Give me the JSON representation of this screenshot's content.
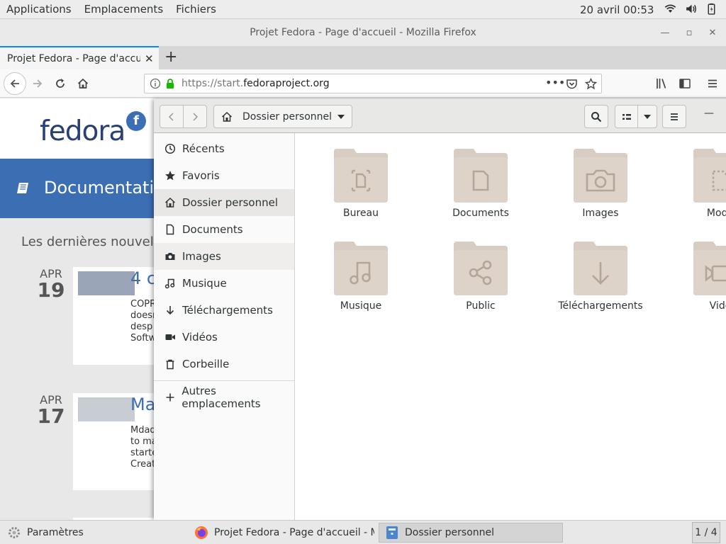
{
  "topbar": {
    "menus": [
      "Applications",
      "Emplacements",
      "Fichiers"
    ],
    "clock": "20 avril  00:53"
  },
  "firefox": {
    "window_title": "Projet Fedora - Page d'accueil - Mozilla Firefox",
    "tab_label": "Projet Fedora - Page d'accueil",
    "url_prefix": "https://start.",
    "url_domain": "fedoraproject.org"
  },
  "page": {
    "logo_text": "fedora",
    "doc_title": "Documentation",
    "news_heading": "Les dernières nouvelles",
    "posts": [
      {
        "month": "APR",
        "day": "19",
        "title": "4 c",
        "excerpt": [
          "COPR",
          "doesn",
          "desp",
          "Softw"
        ]
      },
      {
        "month": "APR",
        "day": "17",
        "title": "Ma",
        "excerpt": [
          "Mdad",
          "to ma",
          "starte",
          "Creat"
        ]
      }
    ]
  },
  "nautilus": {
    "path_label": "Dossier personnel",
    "sidebar": [
      {
        "label": "Récents",
        "icon": "clock-icon"
      },
      {
        "label": "Favoris",
        "icon": "star-icon"
      },
      {
        "label": "Dossier personnel",
        "icon": "home-icon",
        "selected": true
      },
      {
        "label": "Documents",
        "icon": "document-icon"
      },
      {
        "label": "Images",
        "icon": "camera-icon"
      },
      {
        "label": "Musique",
        "icon": "music-icon"
      },
      {
        "label": "Téléchargements",
        "icon": "download-icon"
      },
      {
        "label": "Vidéos",
        "icon": "video-icon"
      },
      {
        "label": "Corbeille",
        "icon": "trash-icon"
      }
    ],
    "other_locations": "Autres emplacements",
    "folders": [
      {
        "label": "Bureau",
        "icon": "desktop-folder-icon"
      },
      {
        "label": "Documents",
        "icon": "documents-folder-icon"
      },
      {
        "label": "Images",
        "icon": "pictures-folder-icon"
      },
      {
        "label": "Modè",
        "icon": "templates-folder-icon"
      },
      {
        "label": "Musique",
        "icon": "music-folder-icon"
      },
      {
        "label": "Public",
        "icon": "public-folder-icon"
      },
      {
        "label": "Téléchargements",
        "icon": "downloads-folder-icon"
      },
      {
        "label": "Vidé",
        "icon": "videos-folder-icon"
      }
    ]
  },
  "taskbar": {
    "tasks": [
      "Paramètres",
      "Projet Fedora - Page d'accueil - Mo...",
      "Dossier personnel"
    ],
    "workspace": "1 / 4"
  },
  "colors": {
    "fedora_blue": "#3c6eb4",
    "folder_tan": "#d8cdc2",
    "firefox_accent": "#0a84ff"
  }
}
